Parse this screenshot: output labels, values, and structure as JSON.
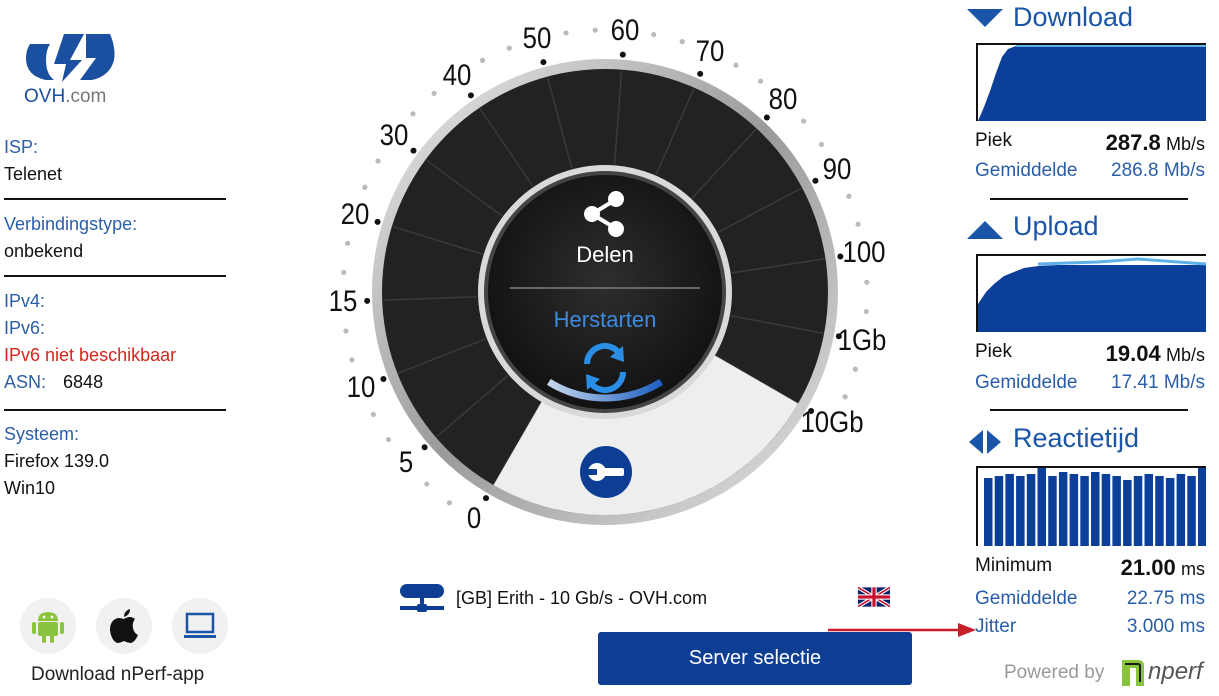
{
  "logo": {
    "brand": "OVH",
    "domain": ".com"
  },
  "info": {
    "isp_label": "ISP:",
    "isp_value": "Telenet",
    "conn_label": "Verbindingstype:",
    "conn_value": "onbekend",
    "ipv4_label": "IPv4:",
    "ipv6_label": "IPv6:",
    "ipv6_status": "IPv6 niet beschikbaar",
    "asn_label": "ASN:",
    "asn_value": "6848",
    "system_label": "Systeem:",
    "browser": "Firefox 139.0",
    "os": "Win10"
  },
  "apps": {
    "label": "Download nPerf-app",
    "items": [
      "android-icon",
      "apple-icon",
      "desktop-icon"
    ]
  },
  "gauge": {
    "scale_labels": [
      "0",
      "5",
      "10",
      "15",
      "20",
      "30",
      "40",
      "50",
      "60",
      "70",
      "80",
      "90",
      "100",
      "1Gb",
      "10Gb"
    ],
    "share_label": "Delen",
    "restart_label": "Herstarten",
    "progress": 0.35
  },
  "server": {
    "name": "[GB] Erith - 10 Gb/s - OVH.com",
    "select_button": "Server selectie"
  },
  "download": {
    "title": "Download",
    "peak_label": "Piek",
    "peak_value": "287.8",
    "peak_unit": "Mb/s",
    "avg_label": "Gemiddelde",
    "avg_value": "286.8 Mb/s"
  },
  "upload": {
    "title": "Upload",
    "peak_label": "Piek",
    "peak_value": "19.04",
    "peak_unit": "Mb/s",
    "avg_label": "Gemiddelde",
    "avg_value": "17.41 Mb/s"
  },
  "latency": {
    "title": "Reactietijd",
    "min_label": "Minimum",
    "min_value": "21.00",
    "min_unit": "ms",
    "avg_label": "Gemiddelde",
    "avg_value": "22.75 ms",
    "jitter_label": "Jitter",
    "jitter_value": "3.000 ms"
  },
  "footer": {
    "powered_by": "Powered by",
    "brand": "nperf"
  },
  "colors": {
    "accent": "#1b55a8",
    "button": "#0e3e94",
    "graph_fill": "#0b3f9a",
    "error": "#d7261c",
    "restart": "#3d8be0"
  }
}
